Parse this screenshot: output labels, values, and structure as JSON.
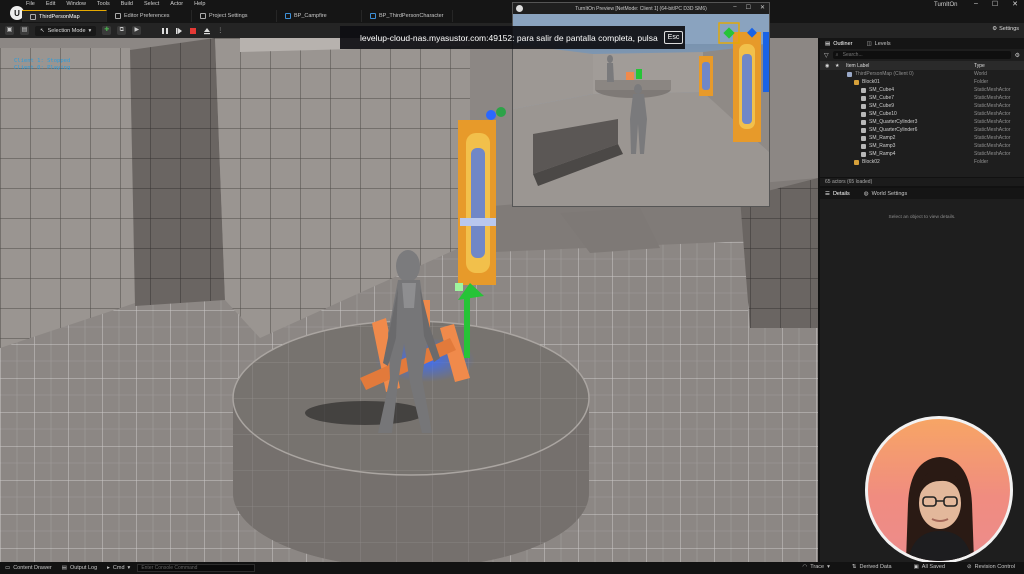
{
  "app": {
    "window_title": "TurnItOn",
    "menu": [
      "File",
      "Edit",
      "Window",
      "Tools",
      "Build",
      "Select",
      "Actor",
      "Help"
    ],
    "window_controls": [
      "–",
      "☐",
      "✕"
    ]
  },
  "tabs": [
    {
      "label": "ThirdPersonMap",
      "active": true
    },
    {
      "label": "Editor Preferences",
      "active": false
    },
    {
      "label": "Project Settings",
      "active": false
    },
    {
      "label": "BP_Campfire",
      "active": false
    },
    {
      "label": "BP_ThirdPersonCharacter",
      "active": false
    }
  ],
  "toolbar": {
    "mode_label": "Selection Mode",
    "settings_label": "Settings"
  },
  "notification": {
    "text": "levelup-cloud-nas.myasustor.com:49152: para salir de pantalla completa, pulsa",
    "key": "Esc"
  },
  "pie_window": {
    "title": "TurnItOn Preview [NetMode: Client 1]  (64-bit/PC D3D SM6)"
  },
  "outliner": {
    "tabs": [
      {
        "label": "Outliner",
        "active": true
      },
      {
        "label": "Levels",
        "active": false
      }
    ],
    "search_placeholder": "Search...",
    "col_label": "Item Label",
    "col_type": "Type",
    "rows": [
      {
        "label": "ThirdPersonMap (Client 0)",
        "type": "World",
        "indent": 1,
        "icon": "world-icon",
        "dim": true
      },
      {
        "label": "Block01",
        "type": "Folder",
        "indent": 2,
        "icon": "folder-icon",
        "dim": false
      },
      {
        "label": "SM_Cube4",
        "type": "StaticMeshActor",
        "indent": 3,
        "icon": "mesh-icon",
        "dim": false
      },
      {
        "label": "SM_Cube7",
        "type": "StaticMeshActor",
        "indent": 3,
        "icon": "mesh-icon",
        "dim": false
      },
      {
        "label": "SM_Cube9",
        "type": "StaticMeshActor",
        "indent": 3,
        "icon": "mesh-icon",
        "dim": false
      },
      {
        "label": "SM_Cube10",
        "type": "StaticMeshActor",
        "indent": 3,
        "icon": "mesh-icon",
        "dim": false
      },
      {
        "label": "SM_QuarterCylinder3",
        "type": "StaticMeshActor",
        "indent": 3,
        "icon": "mesh-icon",
        "dim": false
      },
      {
        "label": "SM_QuarterCylinder6",
        "type": "StaticMeshActor",
        "indent": 3,
        "icon": "mesh-icon",
        "dim": false
      },
      {
        "label": "SM_Ramp2",
        "type": "StaticMeshActor",
        "indent": 3,
        "icon": "mesh-icon",
        "dim": false
      },
      {
        "label": "SM_Ramp3",
        "type": "StaticMeshActor",
        "indent": 3,
        "icon": "mesh-icon",
        "dim": false
      },
      {
        "label": "SM_Ramp4",
        "type": "StaticMeshActor",
        "indent": 3,
        "icon": "mesh-icon",
        "dim": false
      },
      {
        "label": "Block02",
        "type": "Folder",
        "indent": 2,
        "icon": "folder-icon",
        "dim": false
      }
    ],
    "footer": "65 actors (65 loaded)"
  },
  "details": {
    "tabs": [
      {
        "label": "Details",
        "active": true
      },
      {
        "label": "World Settings",
        "active": false
      }
    ],
    "empty_text": "Select an object to view details."
  },
  "statusbar": {
    "content_drawer": "Content Drawer",
    "output_log": "Output Log",
    "cmd": "Cmd",
    "console_placeholder": "Enter Console Command",
    "trace": "Trace",
    "derived_data": "Derived Data",
    "all_saved": "All Saved",
    "revision_control": "Revision Control"
  },
  "colors": {
    "accent_tab": "#e6a900",
    "folder": "#d7a13a",
    "pawn_glow": "#2f6bff",
    "gizmo_green": "#26c437"
  }
}
